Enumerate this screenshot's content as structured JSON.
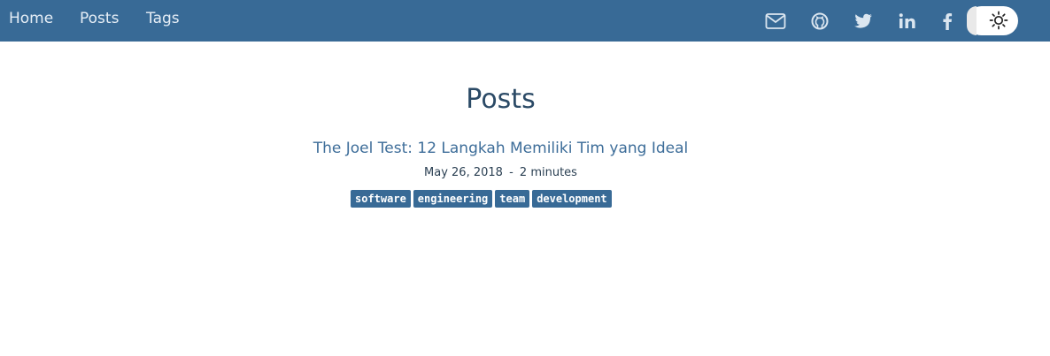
{
  "nav": {
    "links": [
      {
        "label": "Home"
      },
      {
        "label": "Posts"
      },
      {
        "label": "Tags"
      }
    ],
    "social_icons": [
      "mail-icon",
      "github-icon",
      "twitter-icon",
      "linkedin-icon",
      "facebook-icon"
    ],
    "theme_toggle_icon": "sun-icon",
    "background_color": "#386a96"
  },
  "main": {
    "title": "Posts",
    "posts": [
      {
        "title": "The Joel Test: 12 Langkah Memiliki Tim yang Ideal",
        "date": "May 26, 2018",
        "separator": "-",
        "read_time": "2 minutes",
        "tags": [
          "software",
          "engineering",
          "team",
          "development"
        ]
      }
    ]
  }
}
